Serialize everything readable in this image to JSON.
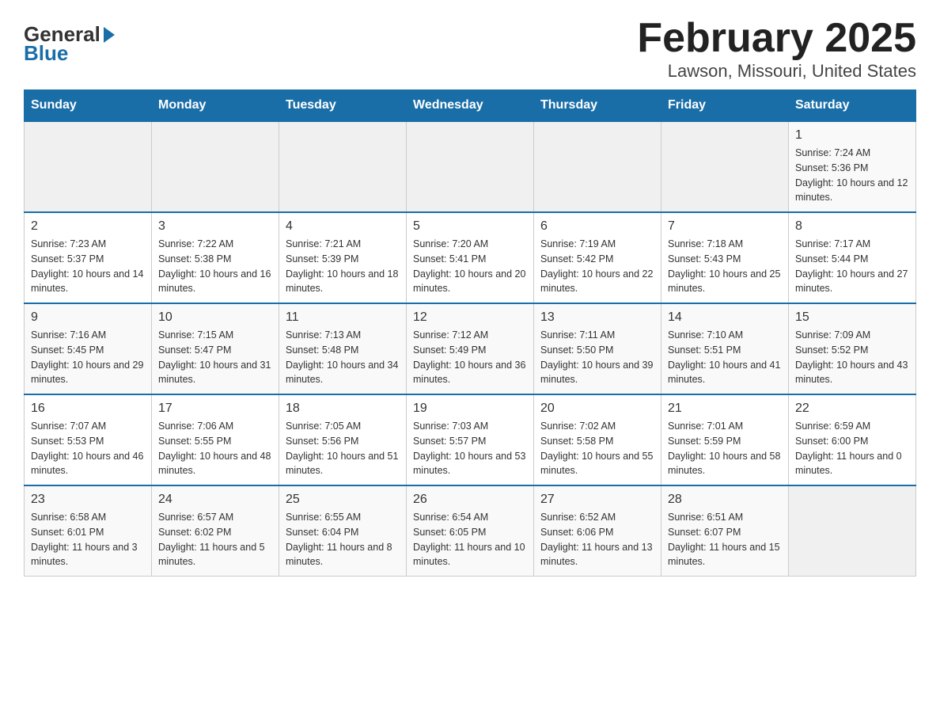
{
  "header": {
    "logo_general": "General",
    "logo_blue": "Blue",
    "title": "February 2025",
    "subtitle": "Lawson, Missouri, United States"
  },
  "calendar": {
    "days_of_week": [
      "Sunday",
      "Monday",
      "Tuesday",
      "Wednesday",
      "Thursday",
      "Friday",
      "Saturday"
    ],
    "weeks": [
      [
        {
          "day": "",
          "sunrise": "",
          "sunset": "",
          "daylight": "",
          "empty": true
        },
        {
          "day": "",
          "sunrise": "",
          "sunset": "",
          "daylight": "",
          "empty": true
        },
        {
          "day": "",
          "sunrise": "",
          "sunset": "",
          "daylight": "",
          "empty": true
        },
        {
          "day": "",
          "sunrise": "",
          "sunset": "",
          "daylight": "",
          "empty": true
        },
        {
          "day": "",
          "sunrise": "",
          "sunset": "",
          "daylight": "",
          "empty": true
        },
        {
          "day": "",
          "sunrise": "",
          "sunset": "",
          "daylight": "",
          "empty": true
        },
        {
          "day": "1",
          "sunrise": "Sunrise: 7:24 AM",
          "sunset": "Sunset: 5:36 PM",
          "daylight": "Daylight: 10 hours and 12 minutes.",
          "empty": false
        }
      ],
      [
        {
          "day": "2",
          "sunrise": "Sunrise: 7:23 AM",
          "sunset": "Sunset: 5:37 PM",
          "daylight": "Daylight: 10 hours and 14 minutes.",
          "empty": false
        },
        {
          "day": "3",
          "sunrise": "Sunrise: 7:22 AM",
          "sunset": "Sunset: 5:38 PM",
          "daylight": "Daylight: 10 hours and 16 minutes.",
          "empty": false
        },
        {
          "day": "4",
          "sunrise": "Sunrise: 7:21 AM",
          "sunset": "Sunset: 5:39 PM",
          "daylight": "Daylight: 10 hours and 18 minutes.",
          "empty": false
        },
        {
          "day": "5",
          "sunrise": "Sunrise: 7:20 AM",
          "sunset": "Sunset: 5:41 PM",
          "daylight": "Daylight: 10 hours and 20 minutes.",
          "empty": false
        },
        {
          "day": "6",
          "sunrise": "Sunrise: 7:19 AM",
          "sunset": "Sunset: 5:42 PM",
          "daylight": "Daylight: 10 hours and 22 minutes.",
          "empty": false
        },
        {
          "day": "7",
          "sunrise": "Sunrise: 7:18 AM",
          "sunset": "Sunset: 5:43 PM",
          "daylight": "Daylight: 10 hours and 25 minutes.",
          "empty": false
        },
        {
          "day": "8",
          "sunrise": "Sunrise: 7:17 AM",
          "sunset": "Sunset: 5:44 PM",
          "daylight": "Daylight: 10 hours and 27 minutes.",
          "empty": false
        }
      ],
      [
        {
          "day": "9",
          "sunrise": "Sunrise: 7:16 AM",
          "sunset": "Sunset: 5:45 PM",
          "daylight": "Daylight: 10 hours and 29 minutes.",
          "empty": false
        },
        {
          "day": "10",
          "sunrise": "Sunrise: 7:15 AM",
          "sunset": "Sunset: 5:47 PM",
          "daylight": "Daylight: 10 hours and 31 minutes.",
          "empty": false
        },
        {
          "day": "11",
          "sunrise": "Sunrise: 7:13 AM",
          "sunset": "Sunset: 5:48 PM",
          "daylight": "Daylight: 10 hours and 34 minutes.",
          "empty": false
        },
        {
          "day": "12",
          "sunrise": "Sunrise: 7:12 AM",
          "sunset": "Sunset: 5:49 PM",
          "daylight": "Daylight: 10 hours and 36 minutes.",
          "empty": false
        },
        {
          "day": "13",
          "sunrise": "Sunrise: 7:11 AM",
          "sunset": "Sunset: 5:50 PM",
          "daylight": "Daylight: 10 hours and 39 minutes.",
          "empty": false
        },
        {
          "day": "14",
          "sunrise": "Sunrise: 7:10 AM",
          "sunset": "Sunset: 5:51 PM",
          "daylight": "Daylight: 10 hours and 41 minutes.",
          "empty": false
        },
        {
          "day": "15",
          "sunrise": "Sunrise: 7:09 AM",
          "sunset": "Sunset: 5:52 PM",
          "daylight": "Daylight: 10 hours and 43 minutes.",
          "empty": false
        }
      ],
      [
        {
          "day": "16",
          "sunrise": "Sunrise: 7:07 AM",
          "sunset": "Sunset: 5:53 PM",
          "daylight": "Daylight: 10 hours and 46 minutes.",
          "empty": false
        },
        {
          "day": "17",
          "sunrise": "Sunrise: 7:06 AM",
          "sunset": "Sunset: 5:55 PM",
          "daylight": "Daylight: 10 hours and 48 minutes.",
          "empty": false
        },
        {
          "day": "18",
          "sunrise": "Sunrise: 7:05 AM",
          "sunset": "Sunset: 5:56 PM",
          "daylight": "Daylight: 10 hours and 51 minutes.",
          "empty": false
        },
        {
          "day": "19",
          "sunrise": "Sunrise: 7:03 AM",
          "sunset": "Sunset: 5:57 PM",
          "daylight": "Daylight: 10 hours and 53 minutes.",
          "empty": false
        },
        {
          "day": "20",
          "sunrise": "Sunrise: 7:02 AM",
          "sunset": "Sunset: 5:58 PM",
          "daylight": "Daylight: 10 hours and 55 minutes.",
          "empty": false
        },
        {
          "day": "21",
          "sunrise": "Sunrise: 7:01 AM",
          "sunset": "Sunset: 5:59 PM",
          "daylight": "Daylight: 10 hours and 58 minutes.",
          "empty": false
        },
        {
          "day": "22",
          "sunrise": "Sunrise: 6:59 AM",
          "sunset": "Sunset: 6:00 PM",
          "daylight": "Daylight: 11 hours and 0 minutes.",
          "empty": false
        }
      ],
      [
        {
          "day": "23",
          "sunrise": "Sunrise: 6:58 AM",
          "sunset": "Sunset: 6:01 PM",
          "daylight": "Daylight: 11 hours and 3 minutes.",
          "empty": false
        },
        {
          "day": "24",
          "sunrise": "Sunrise: 6:57 AM",
          "sunset": "Sunset: 6:02 PM",
          "daylight": "Daylight: 11 hours and 5 minutes.",
          "empty": false
        },
        {
          "day": "25",
          "sunrise": "Sunrise: 6:55 AM",
          "sunset": "Sunset: 6:04 PM",
          "daylight": "Daylight: 11 hours and 8 minutes.",
          "empty": false
        },
        {
          "day": "26",
          "sunrise": "Sunrise: 6:54 AM",
          "sunset": "Sunset: 6:05 PM",
          "daylight": "Daylight: 11 hours and 10 minutes.",
          "empty": false
        },
        {
          "day": "27",
          "sunrise": "Sunrise: 6:52 AM",
          "sunset": "Sunset: 6:06 PM",
          "daylight": "Daylight: 11 hours and 13 minutes.",
          "empty": false
        },
        {
          "day": "28",
          "sunrise": "Sunrise: 6:51 AM",
          "sunset": "Sunset: 6:07 PM",
          "daylight": "Daylight: 11 hours and 15 minutes.",
          "empty": false
        },
        {
          "day": "",
          "sunrise": "",
          "sunset": "",
          "daylight": "",
          "empty": true
        }
      ]
    ]
  }
}
